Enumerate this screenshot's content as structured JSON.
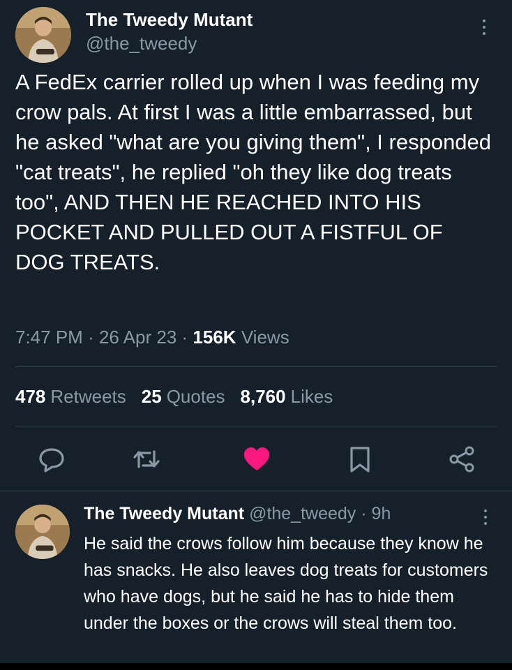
{
  "tweet": {
    "author_name": "The Tweedy Mutant",
    "author_handle": "@the_tweedy",
    "text": "A FedEx carrier rolled up when I was feeding my crow pals. At first I was a little embarrassed, but he asked \"what are you giving them\", I responded \"cat treats\", he replied \"oh they like dog treats too\", AND THEN HE REACHED INTO HIS POCKET AND PULLED OUT A FISTFUL OF DOG TREATS.",
    "time": "7:47 PM",
    "date": "26 Apr 23",
    "separator": "·",
    "views_count": "156K",
    "views_label": "Views"
  },
  "stats": {
    "retweets_count": "478",
    "retweets_label": "Retweets",
    "quotes_count": "25",
    "quotes_label": "Quotes",
    "likes_count": "8,760",
    "likes_label": "Likes"
  },
  "actions": {
    "reply_icon": "speech-bubble-icon",
    "retweet_icon": "retweet-icon",
    "like_icon": "heart-icon",
    "like_color": "#f91880",
    "bookmark_icon": "bookmark-icon",
    "share_icon": "share-icon"
  },
  "reply": {
    "author_name": "The Tweedy Mutant",
    "author_handle": "@the_tweedy",
    "separator": "·",
    "age": "9h",
    "text": "He said the crows follow him because they know he has snacks. He also leaves dog treats for customers who have dogs, but he said he has to hide them under the boxes or the crows will steal them too."
  },
  "theme": {
    "background": "#15202b",
    "secondary_text": "#8b98a5",
    "divider": "#38444d"
  }
}
